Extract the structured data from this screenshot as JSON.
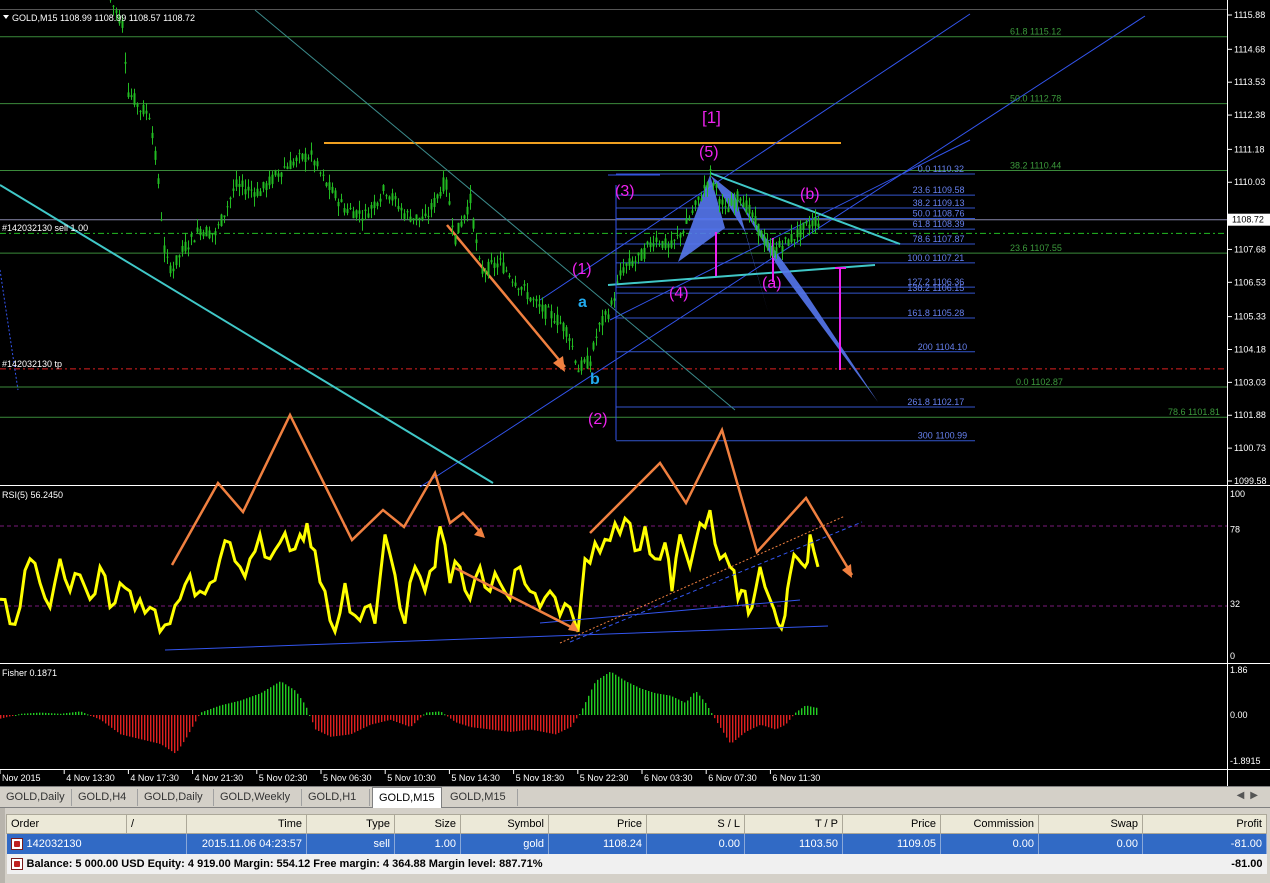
{
  "main_chart": {
    "header": "GOLD,M15  1108.99 1108.99 1108.57 1108.72",
    "price_min": 1099.58,
    "price_max": 1115.88,
    "price_labels": [
      "1115.88",
      "1114.68",
      "1113.53",
      "1112.38",
      "1111.18",
      "1110.03",
      "1108.72",
      "1107.68",
      "1106.53",
      "1105.33",
      "1104.18",
      "1103.03",
      "1101.88",
      "1100.73",
      "1099.58"
    ],
    "current_price": "1108.72",
    "order_label": "#142032130 sell 1.00",
    "tp_label": "#142032130 tp",
    "fib_right": [
      {
        "label": "61.8 1115.12",
        "price": 1115.12
      },
      {
        "label": "50.0 1112.78",
        "price": 1112.78
      },
      {
        "label": "38.2 1110.44",
        "price": 1110.44
      },
      {
        "label": "23.6 1107.55",
        "price": 1107.55
      },
      {
        "label": "0.0 1102.87",
        "price": 1102.87
      },
      {
        "label": "78.6 1101.81",
        "price": 1101.81
      }
    ],
    "fib_extension": [
      {
        "label": "0.0 1110.32",
        "price": 1110.32
      },
      {
        "label": "23.6 1109.58",
        "price": 1109.58
      },
      {
        "label": "38.2 1109.13",
        "price": 1109.13
      },
      {
        "label": "50.0 1108.76",
        "price": 1108.76
      },
      {
        "label": "61.8 1108.39",
        "price": 1108.39
      },
      {
        "label": "78.6 1107.87",
        "price": 1107.87
      },
      {
        "label": "100.0 1107.21",
        "price": 1107.21
      },
      {
        "label": "127.2 1106.36",
        "price": 1106.36
      },
      {
        "label": "138.2 1106.15",
        "price": 1106.15
      },
      {
        "label": "161.8 1105.28",
        "price": 1105.28
      },
      {
        "label": "200 1104.10",
        "price": 1104.1
      },
      {
        "label": "261.8 1102.17",
        "price": 1102.17
      },
      {
        "label": "300 1100.99",
        "price": 1100.99
      }
    ],
    "wave_labels": [
      {
        "text": "[1]",
        "color": "#ee22ee"
      },
      {
        "text": "(5)",
        "color": "#ee22ee"
      },
      {
        "text": "(3)",
        "color": "#ee22ee"
      },
      {
        "text": "(b)",
        "color": "#ee22ee"
      },
      {
        "text": "(1)",
        "color": "#ee22ee"
      },
      {
        "text": "(4)",
        "color": "#ee22ee"
      },
      {
        "text": "(a)",
        "color": "#ee22ee"
      },
      {
        "text": "(2)",
        "color": "#ee22ee"
      },
      {
        "text": "a",
        "color": "#22aaee"
      },
      {
        "text": "b",
        "color": "#22aaee"
      }
    ]
  },
  "rsi_panel": {
    "header": "RSI(5) 56.2450",
    "levels": [
      "100",
      "78",
      "32",
      "0"
    ]
  },
  "fisher_panel": {
    "header": "Fisher 0.1871",
    "levels": [
      "1.86",
      "0.00",
      "-1.8915"
    ]
  },
  "time_axis": [
    "Nov 2015",
    "4 Nov 13:30",
    "4 Nov 17:30",
    "4 Nov 21:30",
    "5 Nov 02:30",
    "5 Nov 06:30",
    "5 Nov 10:30",
    "5 Nov 14:30",
    "5 Nov 18:30",
    "5 Nov 22:30",
    "6 Nov 03:30",
    "6 Nov 07:30",
    "6 Nov 11:30"
  ],
  "tabs": [
    {
      "label": "GOLD,Daily"
    },
    {
      "label": "GOLD,H4"
    },
    {
      "label": "GOLD,Daily"
    },
    {
      "label": "GOLD,Weekly"
    },
    {
      "label": "GOLD,H1"
    },
    {
      "label": "GOLD,M15",
      "active": true
    },
    {
      "label": "GOLD,M15"
    }
  ],
  "terminal": {
    "columns": [
      "Order",
      "/",
      "Time",
      "Type",
      "Size",
      "Symbol",
      "Price",
      "S / L",
      "T / P",
      "Price",
      "Commission",
      "Swap",
      "Profit"
    ],
    "order": {
      "id": "142032130",
      "time": "2015.11.06 04:23:57",
      "type": "sell",
      "size": "1.00",
      "symbol": "gold",
      "price": "1108.24",
      "sl": "0.00",
      "tp": "1103.50",
      "current": "1109.05",
      "commission": "0.00",
      "swap": "0.00",
      "profit": "-81.00"
    },
    "balance_text": "Balance: 5 000.00 USD  Equity: 4 919.00  Margin: 554.12  Free margin: 4 364.88  Margin level: 887.71%",
    "balance_profit": "-81.00"
  },
  "colors": {
    "candle": "#22bb22",
    "rsi": "#ffff00",
    "fisher_up": "#22cc22",
    "fisher_down": "#dd2020",
    "fib": "#3b8a3b",
    "fib_ext": "#3355cc",
    "orange": "#f08040",
    "cyan": "#40c8c8",
    "magenta": "#ee22ee",
    "blue": "#3355ee"
  }
}
